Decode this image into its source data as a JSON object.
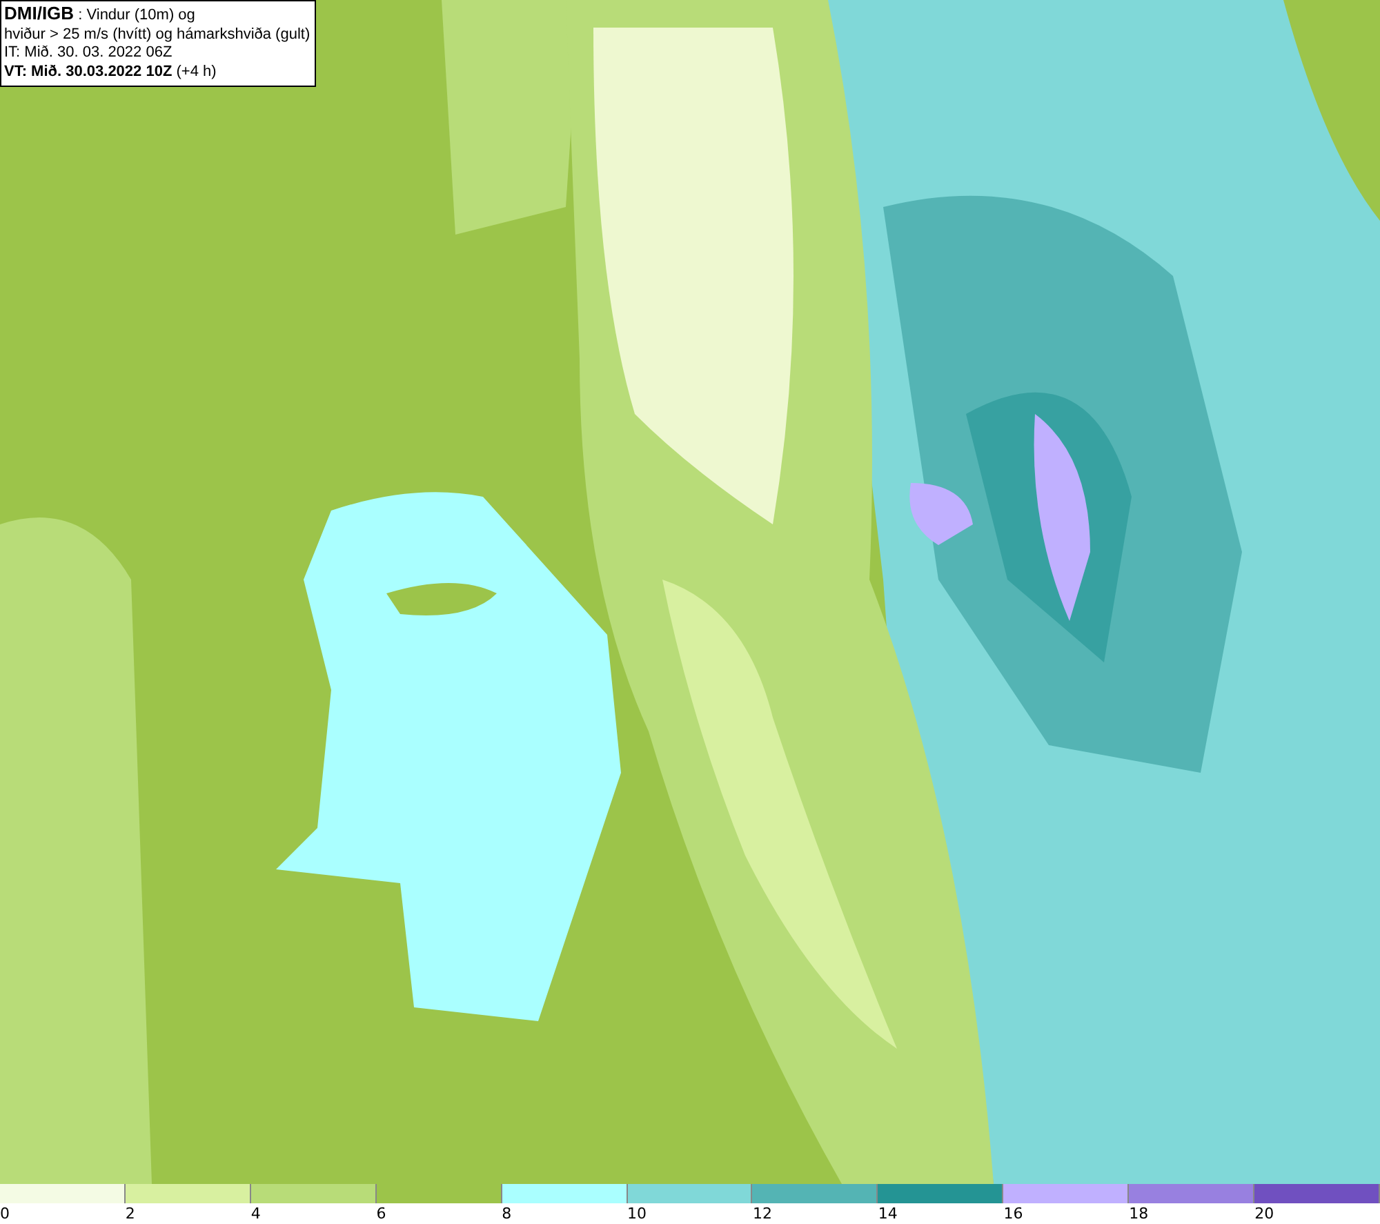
{
  "info_box": {
    "lines": [
      "**DMI/IGB** : Vindur (10m) og",
      "hviður > 25 m/s (hvítt) og hámarkshviða (gult)",
      "IT: Mið. 30. 03. 2022 06Z",
      "**VT: Mið. 30.03.2022 10Z** (+4 h)"
    ]
  },
  "legend": [
    {
      "label": "0",
      "color": "#f4fbe4"
    },
    {
      "label": "2",
      "color": "#d8f0a0"
    },
    {
      "label": "4",
      "color": "#b8dc78"
    },
    {
      "label": "6",
      "color": "#9cc44a"
    },
    {
      "label": "8",
      "color": "#aaffff"
    },
    {
      "label": "10",
      "color": "#80d8d8"
    },
    {
      "label": "12",
      "color": "#54b4b4"
    },
    {
      "label": "14",
      "color": "#249494"
    },
    {
      "label": "16",
      "color": "#c0b0ff"
    },
    {
      "label": "18",
      "color": "#9880e0"
    },
    {
      "label": "20",
      "color": "#7050c0"
    }
  ]
}
